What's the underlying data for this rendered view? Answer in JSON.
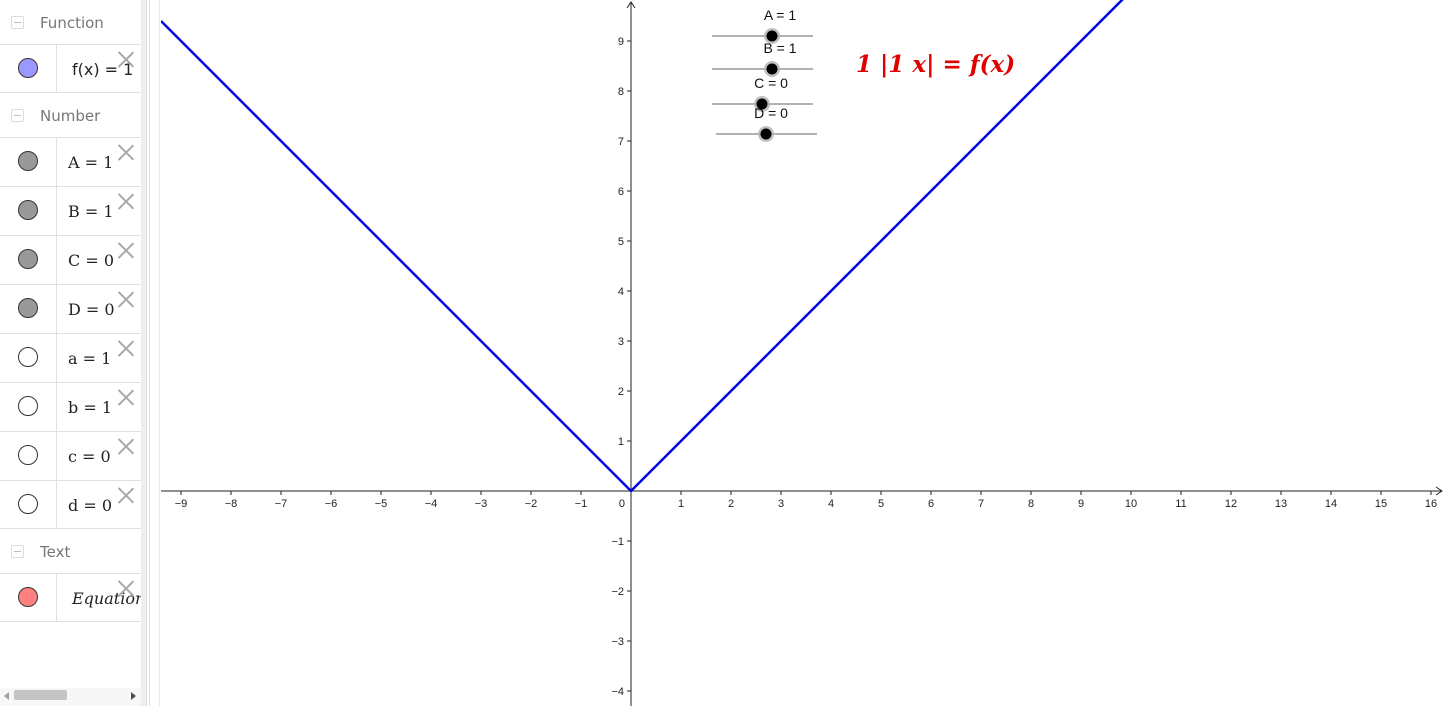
{
  "colors": {
    "function_line": "#0000e6",
    "function_marble": "#9999ff",
    "number_marble": "#999999",
    "text_marble": "#ff8080",
    "equation_text": "#e00000"
  },
  "algebra": {
    "groups": [
      {
        "label": "Function",
        "items": [
          {
            "text": "f(x) = 1",
            "marble": "#9999ff",
            "style": "sans"
          }
        ]
      },
      {
        "label": "Number",
        "items": [
          {
            "text": "A = 1",
            "marble": "#999999"
          },
          {
            "text": "B = 1",
            "marble": "#999999"
          },
          {
            "text": "C = 0",
            "marble": "#999999"
          },
          {
            "text": "D = 0",
            "marble": "#999999"
          },
          {
            "text": "a = 1",
            "marble": "#ffffff"
          },
          {
            "text": "b = 1",
            "marble": "#ffffff"
          },
          {
            "text": "c = 0",
            "marble": "#ffffff"
          },
          {
            "text": "d = 0",
            "marble": "#ffffff"
          }
        ]
      },
      {
        "label": "Text",
        "items": [
          {
            "text": "Equation",
            "marble": "#ff8080",
            "style": "italic"
          }
        ]
      }
    ]
  },
  "graphics": {
    "x_ticks": [
      -9,
      -8,
      -7,
      -6,
      -5,
      -4,
      -3,
      -2,
      -1,
      1,
      2,
      3,
      4,
      5,
      6,
      7,
      8,
      9,
      10,
      11,
      12,
      13,
      14,
      15,
      16
    ],
    "y_ticks": [
      -4,
      -3,
      -2,
      -1,
      1,
      2,
      3,
      4,
      5,
      6,
      7,
      8,
      9
    ],
    "origin_label": "0",
    "xlim": [
      -9.4,
      16.5
    ],
    "ylim": [
      -4.2,
      9.8
    ],
    "function": {
      "A": 1,
      "B": 1,
      "C": 0,
      "D": 0
    },
    "sliders": [
      {
        "caption": "A = 1",
        "value": 1
      },
      {
        "caption": "B = 1",
        "value": 1
      },
      {
        "caption": "C = 0",
        "value": 0
      },
      {
        "caption": "D = 0",
        "value": 0
      }
    ],
    "equation": "1 |1 x| = f(x)"
  }
}
